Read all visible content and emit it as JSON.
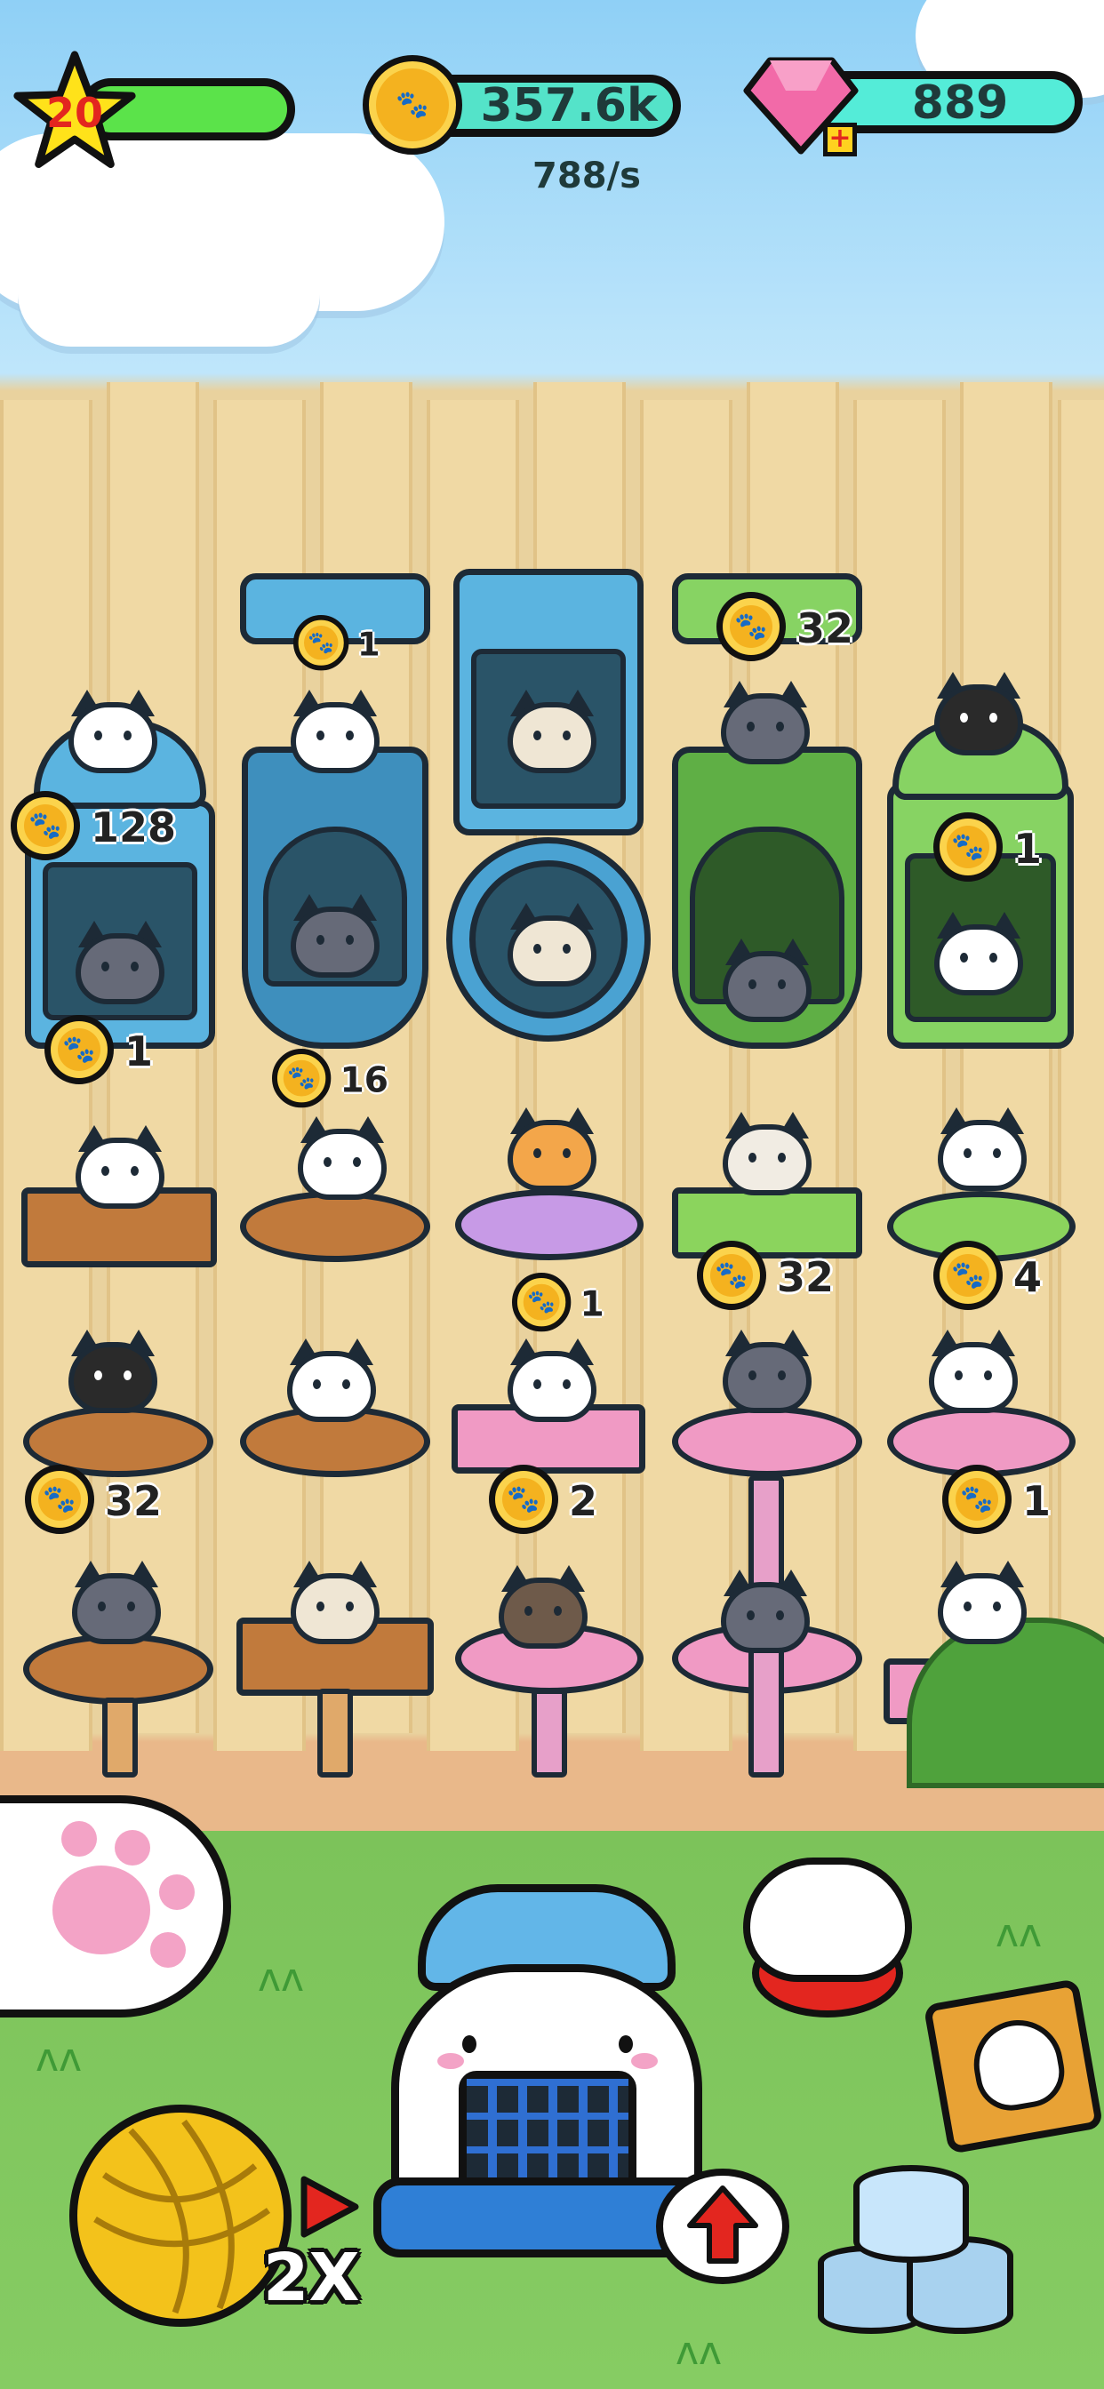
{
  "hud": {
    "level": "20",
    "coins": "357.6k",
    "rate": "788/s",
    "gems": "889"
  },
  "colors": {
    "level_bar": "#5be34a",
    "coin_bar": "#54e3c9",
    "gem_bar": "#54ecd8",
    "star": "#ffe21a",
    "gem": "#f26aa8"
  },
  "icons": [
    "star-icon",
    "paw-coin-icon",
    "gem-icon",
    "plus-icon",
    "yarn-ball-icon",
    "play-arrow-icon",
    "upgrade-arrow-icon",
    "cat-food-cans-icon",
    "cat-book-icon",
    "cat-paw-icon"
  ],
  "tower_badges": {
    "b1": "128",
    "b2": "1",
    "b3": "1",
    "b4": "16",
    "b5": "32",
    "b6": "1",
    "b7": "1",
    "b8": "32",
    "b9": "4",
    "b10": "32",
    "b11": "2",
    "b12": "1"
  },
  "bottom": {
    "speed_label": "2X"
  }
}
